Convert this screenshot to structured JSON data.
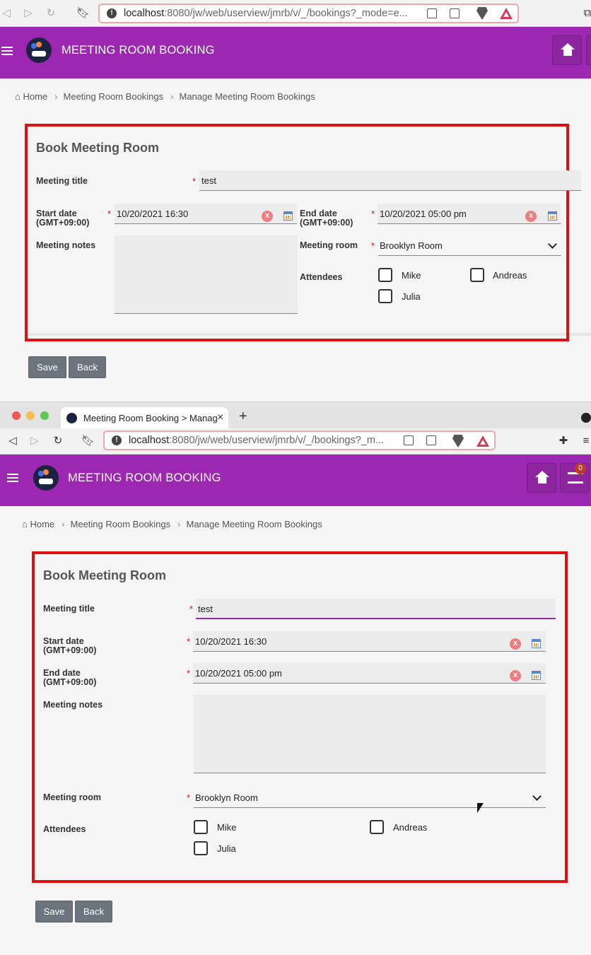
{
  "browser": {
    "url": "localhost:8080/jw/web/userview/jmrb/v/_/bookings?_mode=e...",
    "url_host": "localhost",
    "url_rest_top": ":8080/jw/web/userview/jmrb/v/_/bookings?_mode=e...",
    "url_rest_bottom": ":8080/jw/web/userview/jmrb/v/_/bookings?_m...",
    "tab_title": "Meeting Room Booking > Manag",
    "tab_close": "×",
    "new_tab": "+"
  },
  "app": {
    "title": "MEETING ROOM BOOKING",
    "notification_count": "0"
  },
  "breadcrumb": {
    "home": "Home",
    "level1": "Meeting Room Bookings",
    "level2": "Manage Meeting Room Bookings"
  },
  "form": {
    "title": "Book Meeting Room",
    "meeting_title_label": "Meeting title",
    "meeting_title_value": "test",
    "start_date_label": "Start date",
    "end_date_label": "End date",
    "timezone": "(GMT+09:00)",
    "start_date_value": "10/20/2021 16:30",
    "end_date_value": "10/20/2021 05:00 pm",
    "notes_label": "Meeting notes",
    "room_label": "Meeting room",
    "room_value": "Brooklyn Room",
    "attendees_label": "Attendees",
    "attendees": [
      "Mike",
      "Andreas",
      "Julia"
    ],
    "required_mark": "*",
    "clear_mark": "x"
  },
  "buttons": {
    "save": "Save",
    "back": "Back"
  },
  "colors": {
    "brand": "#9c27b0",
    "highlight_border": "#e01010",
    "button": "#6c757d"
  }
}
